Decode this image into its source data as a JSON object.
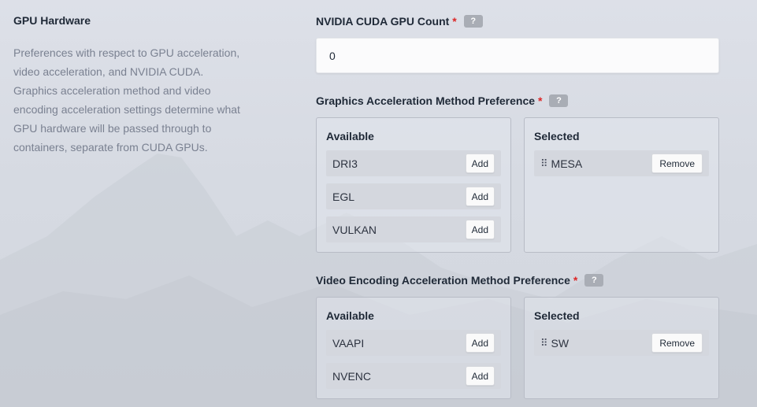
{
  "section": {
    "title": "GPU Hardware",
    "description": "Preferences with respect to GPU acceleration, video acceleration, and NVIDIA CUDA. Graphics acceleration method and video encoding acceleration settings determine what GPU hardware will be passed through to containers, separate from CUDA GPUs."
  },
  "cuda": {
    "label": "NVIDIA CUDA GPU Count",
    "required_mark": "*",
    "help": "?",
    "value": "0"
  },
  "graphics": {
    "label": "Graphics Acceleration Method Preference",
    "required_mark": "*",
    "help": "?",
    "available_title": "Available",
    "selected_title": "Selected",
    "available": [
      {
        "label": "DRI3",
        "action": "Add"
      },
      {
        "label": "EGL",
        "action": "Add"
      },
      {
        "label": "VULKAN",
        "action": "Add"
      }
    ],
    "selected": [
      {
        "label": "MESA",
        "action": "Remove",
        "icon": "drag-handle-icon"
      }
    ]
  },
  "video": {
    "label": "Video Encoding Acceleration Method Preference",
    "required_mark": "*",
    "help": "?",
    "available_title": "Available",
    "selected_title": "Selected",
    "available": [
      {
        "label": "VAAPI",
        "action": "Add"
      },
      {
        "label": "NVENC",
        "action": "Add"
      }
    ],
    "selected": [
      {
        "label": "SW",
        "action": "Remove",
        "icon": "drag-handle-icon"
      }
    ]
  }
}
